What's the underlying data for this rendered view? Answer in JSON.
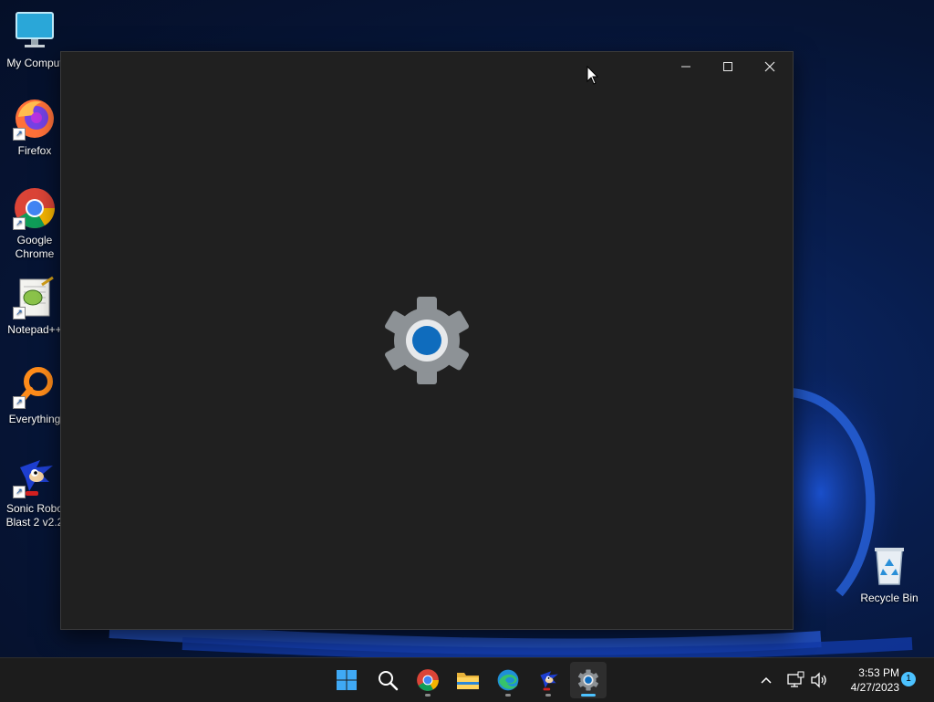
{
  "desktop": {
    "icons": [
      {
        "label": "My Comput",
        "icon": "computer-monitor-icon"
      },
      {
        "label": "Firefox",
        "icon": "firefox-icon"
      },
      {
        "label": "Google\nChrome",
        "icon": "chrome-icon"
      },
      {
        "label": "Notepad++",
        "icon": "notepad-plus-plus-icon"
      },
      {
        "label": "Everything",
        "icon": "everything-search-icon"
      },
      {
        "label": "Sonic Robo\nBlast 2 v2.2",
        "icon": "sonic-icon"
      },
      {
        "label": "Recycle Bin",
        "icon": "recycle-bin-icon"
      }
    ],
    "shortcut_arrow": "↗"
  },
  "window": {
    "app": "Settings",
    "splash_icon": "settings-gear-icon",
    "caption_buttons": [
      "minimize",
      "maximize",
      "close"
    ]
  },
  "taskbar": {
    "buttons": [
      "start",
      "search",
      "chrome",
      "file-explorer",
      "edge",
      "sonic",
      "settings"
    ],
    "active": "settings",
    "clock": {
      "time": "3:53 PM",
      "date": "4/27/2023"
    },
    "notification_count": "1"
  },
  "colors": {
    "window_bg": "#202020",
    "taskbar_bg": "#1c1c1c",
    "accent": "#4cc2ff",
    "gear_center": "#0f6cbd"
  }
}
